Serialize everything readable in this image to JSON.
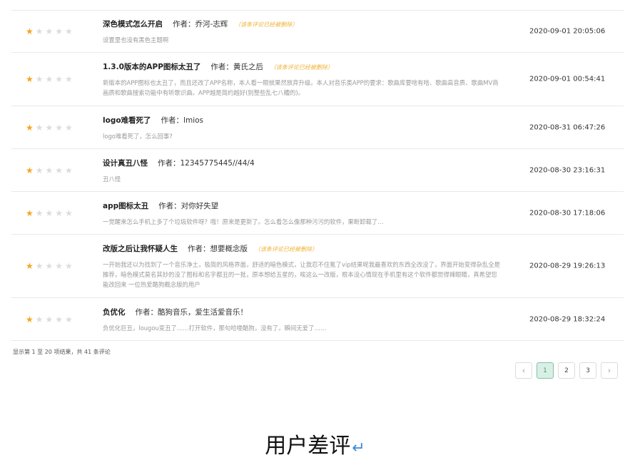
{
  "reviews": [
    {
      "title": "深色模式怎么开启",
      "author_label": "作者：",
      "author": "乔河-志辉",
      "deleted_note": "（该条评论已经被删除）",
      "text": "设置里也没有黑色主题啊",
      "time": "2020-09-01 20:05:06",
      "rating": 1
    },
    {
      "title": "1.3.0版本的APP图标太丑了",
      "author_label": "作者：",
      "author": "黄氏之后",
      "deleted_note": "（该条评论已经被删除）",
      "text": "新版本的APP图标也太丑了，而且还改了APP名称，本人看一眼就果然放弃升级。本人对音乐类APP的要求：歌曲库要啥有啥、歌曲高音质、歌曲MV商画质和歌曲搜索功能中有听歌识曲。APP越是简约越好(别整些乱七八糟的)。",
      "time": "2020-09-01 00:54:41",
      "rating": 1
    },
    {
      "title": "logo难看死了",
      "author_label": "作者：",
      "author": "lmios",
      "deleted_note": "",
      "text": "logo难看死了，怎么回事?",
      "time": "2020-08-31 06:47:26",
      "rating": 1
    },
    {
      "title": "设计真丑八怪",
      "author_label": "作者：",
      "author": "12345775445//44/4",
      "deleted_note": "",
      "text": "丑八怪",
      "time": "2020-08-30 23:16:31",
      "rating": 1
    },
    {
      "title": "app图标太丑",
      "author_label": "作者：",
      "author": "对你好失望",
      "deleted_note": "",
      "text": "一觉醒来怎么手机上多了个垃圾软件呀？哦！原来是更新了。怎么看怎么像那种污污的软件，果断卸载了…",
      "time": "2020-08-30 17:18:06",
      "rating": 1
    },
    {
      "title": "改版之后让我怀疑人生",
      "author_label": "作者：",
      "author": "想要概念版",
      "deleted_note": "（该条评论已经被删除）",
      "text": "一开始我还以为找到了一个音乐净土，极简的风格界面，舒适的暗色模式，让我忍不住氪了vip结果呢我最喜欢的东西全改没了，界面开始变得杂乱全是推荐，暗色模式莫名其妙的没了图标和名字都丑的一批，原本想给五星的，唉这么一改版，根本没心情现在手机里有这个软件都觉得辣眼睛，真希望您能改回来 一位热爱酷狗概念版的用户",
      "time": "2020-08-29 19:26:13",
      "rating": 1
    },
    {
      "title": "负优化",
      "author_label": "作者：",
      "author": "酷狗音乐，爱生活爱音乐！",
      "deleted_note": "",
      "text": "负优化巨丑，lougou变丑了……打开软件，那句哈喽酷狗，没有了。瞬间无爱了……",
      "time": "2020-08-29 18:32:24",
      "rating": 1
    }
  ],
  "summary": "显示第 1 至 20 项结果，共 41 条评论",
  "pagination": {
    "prev": "‹",
    "pages": [
      "1",
      "2",
      "3"
    ],
    "active": "1",
    "next": "›"
  },
  "caption": "用户差评",
  "caption_mark": "↵",
  "colors": {
    "star": "#f7a520",
    "deleted_note": "#f0b030",
    "active_page": "#d9efe5"
  }
}
